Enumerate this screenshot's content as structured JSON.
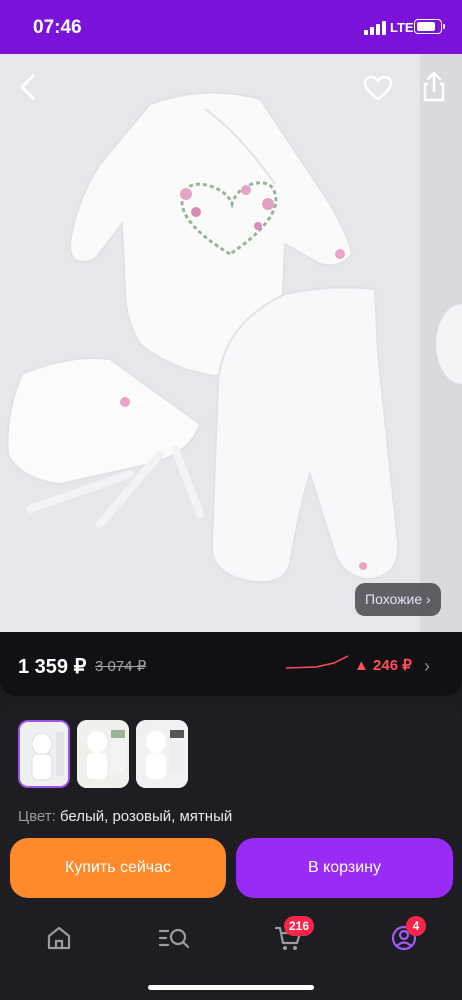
{
  "status_bar": {
    "time": "07:46",
    "network": "LTE",
    "battery_level": 0.8
  },
  "product": {
    "image_icon": "baby-clothing-set"
  },
  "similar_button": {
    "label": "Похожие ›"
  },
  "price": {
    "current": "1 359 ₽",
    "old": "3 074 ₽",
    "change": "▲ 246 ₽",
    "change_color": "#ff4d5a"
  },
  "color_option": {
    "label": "Цвет:",
    "value": "белый, розовый, мятный"
  },
  "actions": {
    "buy_now": "Купить сейчас",
    "add_to_cart": "В корзину"
  },
  "tabbar": {
    "cart_badge": "216",
    "profile_badge": "4"
  },
  "colors": {
    "accent": "#7b12d9",
    "buy": "#ff8a2b",
    "cart": "#9a2bf6",
    "badge": "#f5264a"
  }
}
